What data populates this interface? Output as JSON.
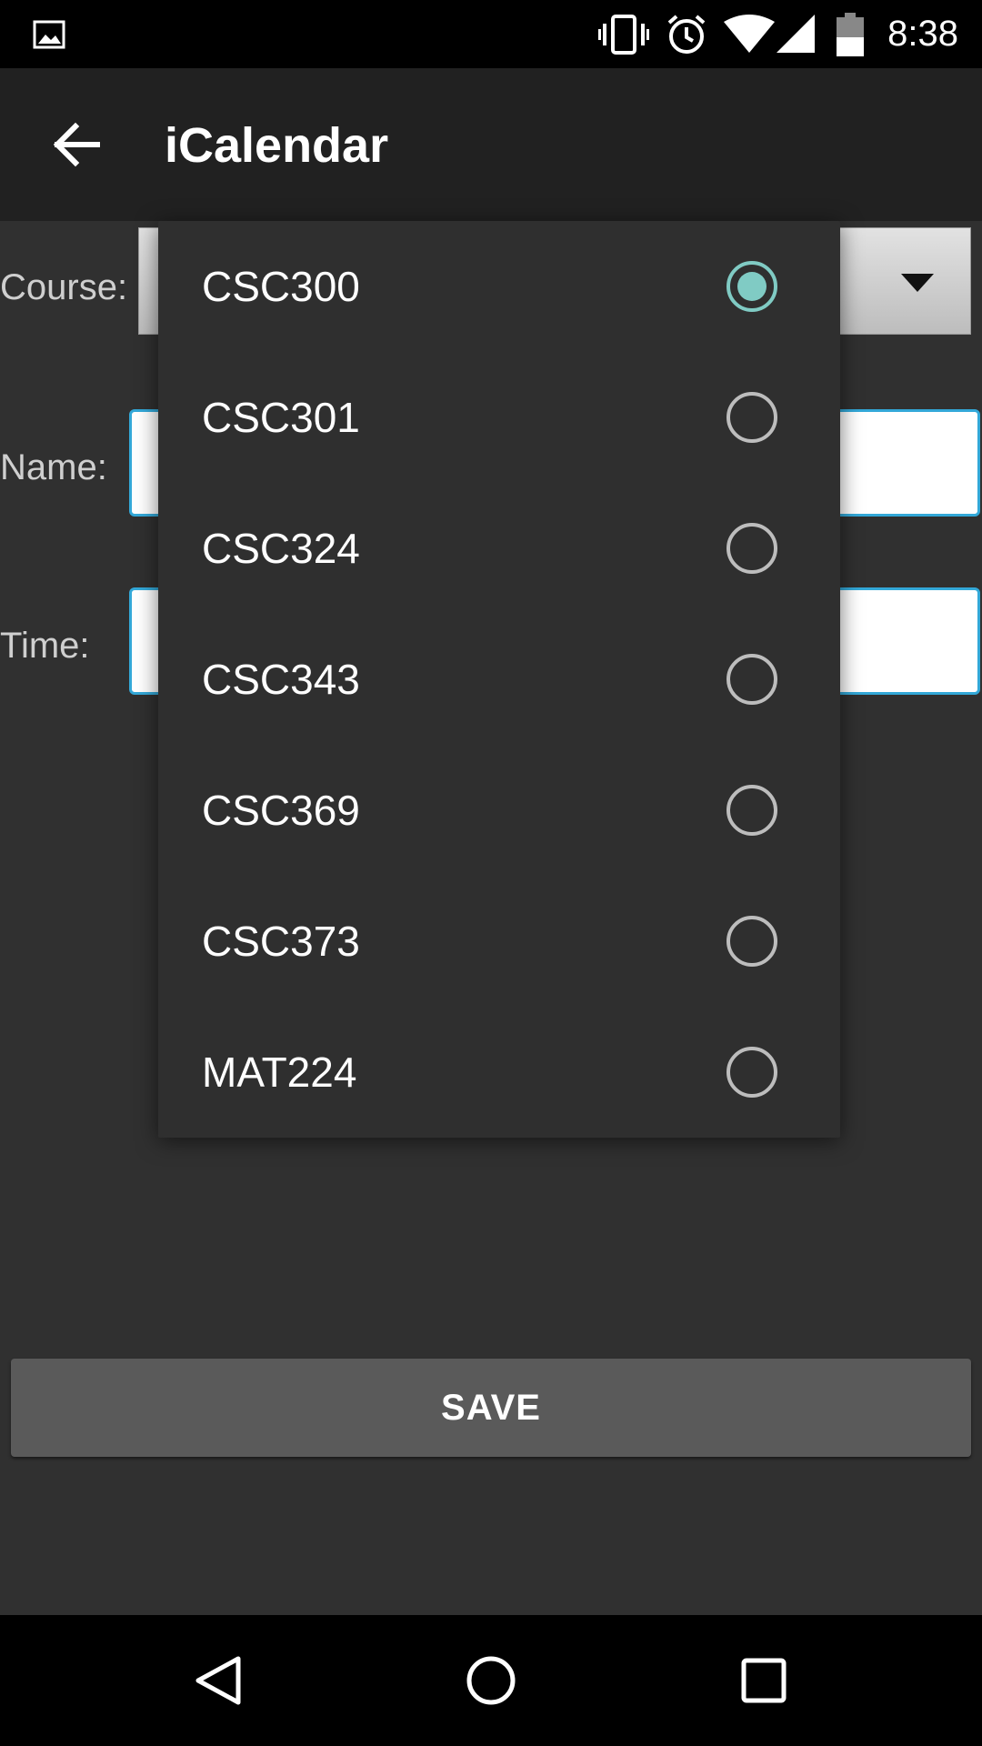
{
  "status_bar": {
    "time": "8:38",
    "icons": [
      "image-icon",
      "vibrate-icon",
      "alarm-icon",
      "wifi-icon",
      "signal-icon",
      "battery-icon"
    ]
  },
  "app_bar": {
    "title": "iCalendar",
    "back_icon": "arrow-back-icon"
  },
  "form": {
    "course_label": "Course:",
    "name_label": "Name:",
    "time_label": "Time:",
    "save_label": "SAVE"
  },
  "dropdown": {
    "selected": "CSC300",
    "options": [
      {
        "label": "CSC300",
        "checked": true
      },
      {
        "label": "CSC301",
        "checked": false
      },
      {
        "label": "CSC324",
        "checked": false
      },
      {
        "label": "CSC343",
        "checked": false
      },
      {
        "label": "CSC369",
        "checked": false
      },
      {
        "label": "CSC373",
        "checked": false
      },
      {
        "label": "MAT224",
        "checked": false
      }
    ]
  },
  "nav_bar": {
    "icons": [
      "back-triangle-icon",
      "home-circle-icon",
      "recents-square-icon"
    ]
  },
  "colors": {
    "accent": "#80cbc4",
    "field_border": "#33a8d8",
    "background": "#303030",
    "app_bar": "#212121"
  }
}
